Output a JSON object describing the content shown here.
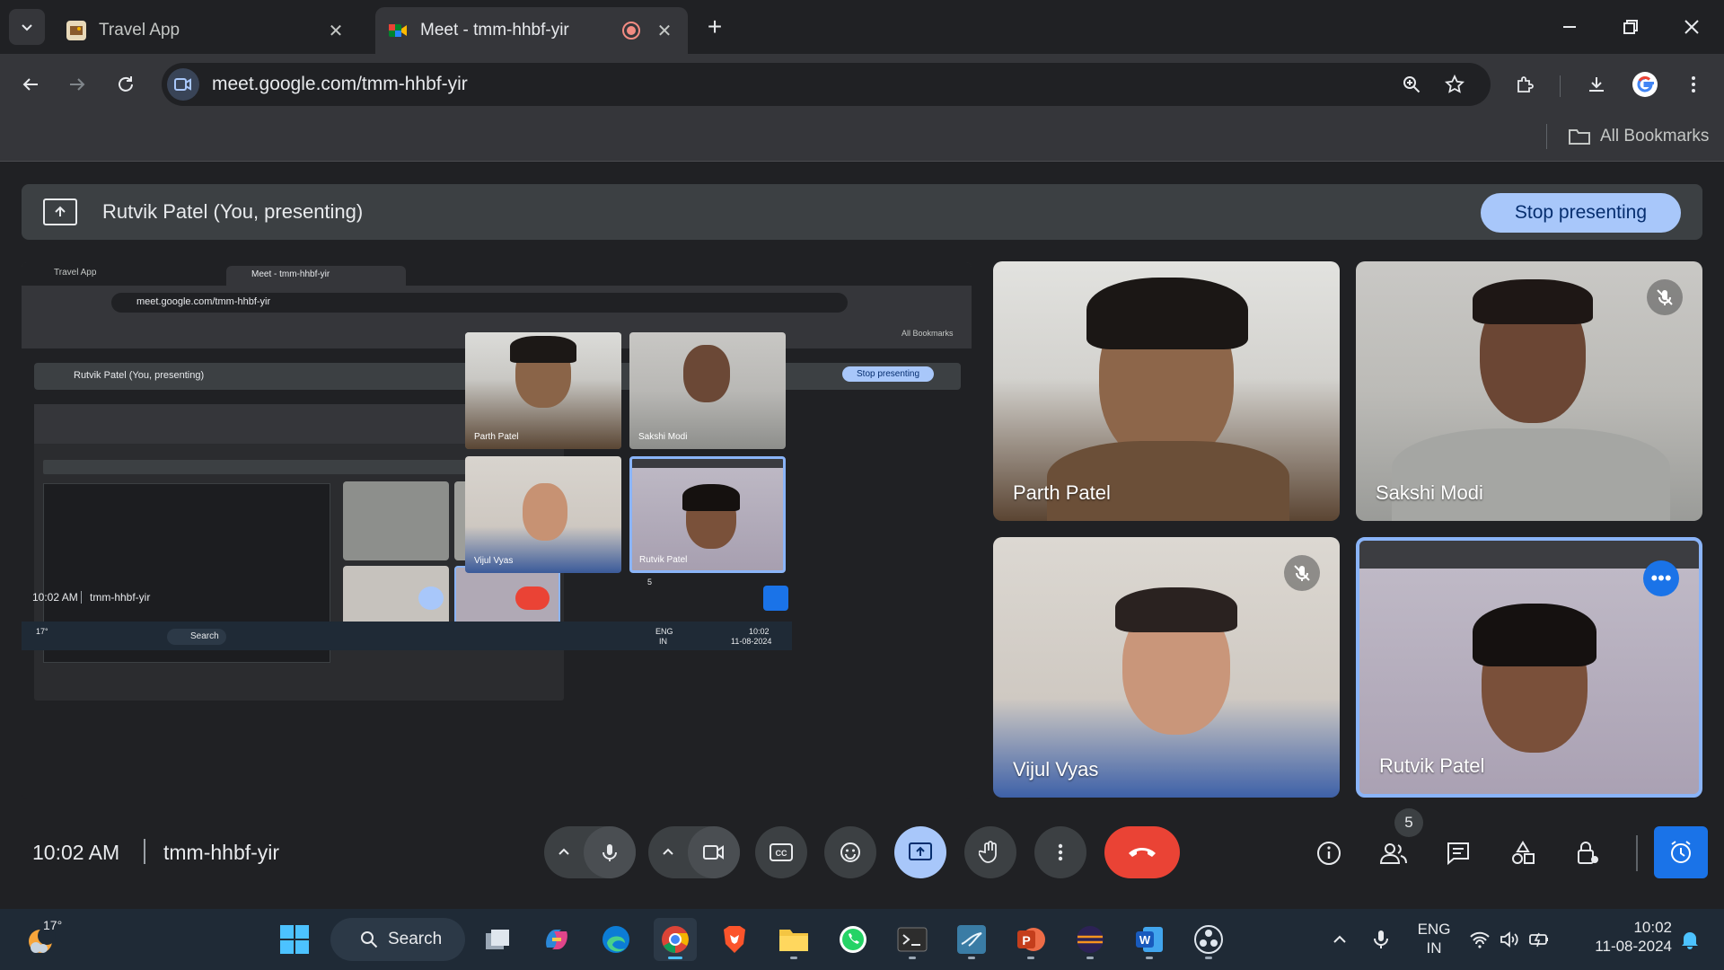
{
  "browser": {
    "tabs": [
      {
        "title": "Travel App",
        "active": false
      },
      {
        "title": "Meet - tmm-hhbf-yir",
        "active": true
      }
    ],
    "url": "meet.google.com/tmm-hhbf-yir",
    "bookmarks_label": "All Bookmarks",
    "tab_close_glyph": "✕",
    "new_tab_glyph": "+"
  },
  "meet": {
    "presenting_label": "Rutvik Patel (You, presenting)",
    "stop_presenting": "Stop presenting",
    "participants": [
      {
        "name": "Parth Patel",
        "muted": false
      },
      {
        "name": "Sakshi Modi",
        "muted": true
      },
      {
        "name": "Vijul Vyas",
        "muted": true
      },
      {
        "name": "Rutvik Patel",
        "muted": false,
        "self": true
      }
    ],
    "time": "10:02 AM",
    "meeting_code": "tmm-hhbf-yir",
    "participant_count": "5",
    "more_glyph": "•••",
    "colors": {
      "accent": "#a8c7fa",
      "end_call": "#ea4335",
      "active_blue": "#1a73e8"
    }
  },
  "taskbar": {
    "weather": "17°",
    "search_label": "Search",
    "lang_line1": "ENG",
    "lang_line2": "IN",
    "clock_time": "10:02",
    "clock_date": "11-08-2024"
  },
  "preview": {
    "tab1": "Travel App",
    "tab2": "Meet - tmm-hhbf-yir",
    "url": "meet.google.com/tmm-hhbf-yir",
    "bookmarks": "All Bookmarks",
    "presenting_label": "Rutvik Patel (You, presenting)",
    "stop_presenting": "Stop presenting",
    "time": "10:02 AM",
    "meeting_code": "tmm-hhbf-yir",
    "participants": [
      "Parth Patel",
      "Sakshi Modi",
      "Vijul Vyas",
      "Rutvik Patel"
    ],
    "participant_count": "5",
    "weather": "17°",
    "search_label": "Search",
    "lang_line1": "ENG",
    "lang_line2": "IN",
    "clock_time": "10:02",
    "clock_date": "11-08-2024"
  }
}
